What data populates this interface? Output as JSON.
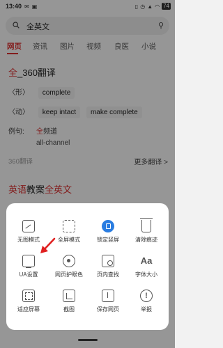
{
  "status": {
    "time": "13:40",
    "battery": "74"
  },
  "search": {
    "query": "全英文"
  },
  "tabs": [
    "网页",
    "资讯",
    "图片",
    "视频",
    "良医",
    "小说"
  ],
  "card": {
    "title_hl": "全",
    "title_rest": "_360翻译",
    "form_label": "〈形〉",
    "form_chip": "complete",
    "verb_label": "〈动〉",
    "verb_chips": [
      "keep intact",
      "make complete"
    ],
    "example_label": "例句:",
    "example_hl": "全",
    "example_rest": "频道",
    "example_en": "all-channel",
    "source": "360翻译",
    "more": "更多翻译 >"
  },
  "result2": {
    "pre": "英语",
    "mid": "教案",
    "hl": "全英文"
  },
  "menu": {
    "items": [
      {
        "label": "无图模式",
        "icon": "no-image-icon"
      },
      {
        "label": "全屏模式",
        "icon": "fullscreen-icon"
      },
      {
        "label": "锁定竖屏",
        "icon": "lock-portrait-icon"
      },
      {
        "label": "清除痕迹",
        "icon": "trash-icon"
      },
      {
        "label": "UA设置",
        "icon": "ua-monitor-icon"
      },
      {
        "label": "网页护眼色",
        "icon": "eye-care-icon"
      },
      {
        "label": "页内查找",
        "icon": "find-in-page-icon"
      },
      {
        "label": "字体大小",
        "icon": "font-size-icon"
      },
      {
        "label": "适应屏幕",
        "icon": "fit-screen-icon"
      },
      {
        "label": "截图",
        "icon": "screenshot-icon"
      },
      {
        "label": "保存网页",
        "icon": "save-page-icon"
      },
      {
        "label": "举报",
        "icon": "report-icon"
      }
    ],
    "accent": "#2a7de1",
    "highlight": "#d32f2f"
  }
}
